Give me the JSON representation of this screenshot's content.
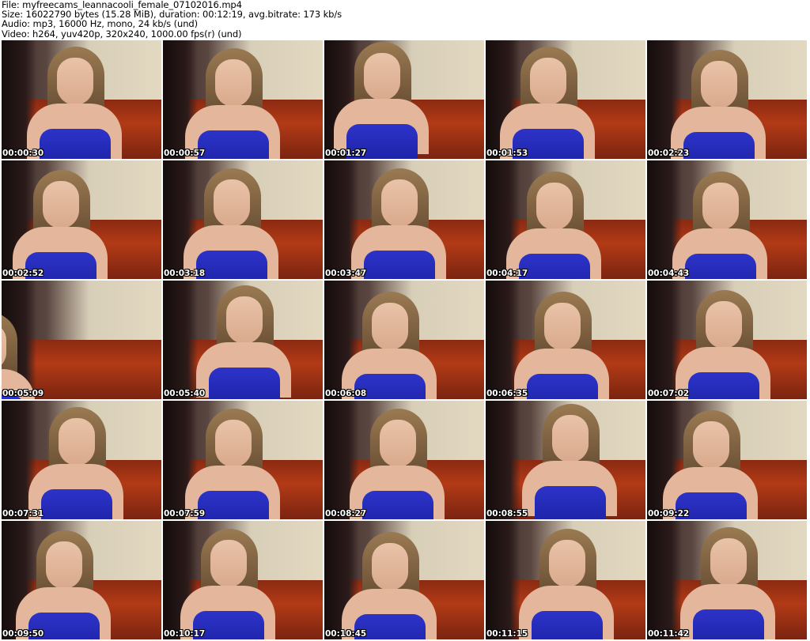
{
  "header": {
    "file_line": "File: myfreecams_leannacooli_female_07102016.mp4",
    "size_line": "Size: 16022790 bytes (15.28 MiB), duration: 00:12:19, avg.bitrate: 173 kb/s",
    "audio_line": "Audio: mp3, 16000 Hz, mono, 24 kb/s (und)",
    "video_line": "Video: h264, yuv420p, 320x240, 1000.00 fps(r) (und)"
  },
  "thumbnails": [
    {
      "timestamp": "00:00:30"
    },
    {
      "timestamp": "00:00:57"
    },
    {
      "timestamp": "00:01:27"
    },
    {
      "timestamp": "00:01:53"
    },
    {
      "timestamp": "00:02:23"
    },
    {
      "timestamp": "00:02:52"
    },
    {
      "timestamp": "00:03:18"
    },
    {
      "timestamp": "00:03:47"
    },
    {
      "timestamp": "00:04:17"
    },
    {
      "timestamp": "00:04:43"
    },
    {
      "timestamp": "00:05:09"
    },
    {
      "timestamp": "00:05:40"
    },
    {
      "timestamp": "00:06:08"
    },
    {
      "timestamp": "00:06:35"
    },
    {
      "timestamp": "00:07:02"
    },
    {
      "timestamp": "00:07:31"
    },
    {
      "timestamp": "00:07:59"
    },
    {
      "timestamp": "00:08:27"
    },
    {
      "timestamp": "00:08:55"
    },
    {
      "timestamp": "00:09:22"
    },
    {
      "timestamp": "00:09:50"
    },
    {
      "timestamp": "00:10:17"
    },
    {
      "timestamp": "00:10:45"
    },
    {
      "timestamp": "00:11:15"
    },
    {
      "timestamp": "00:11:42"
    }
  ],
  "colors": {
    "background": "#ffffff",
    "timestamp_text": "#ffffff",
    "timestamp_outline": "#000000",
    "top_blue": "#2d33c8",
    "bed_red": "#b23a16"
  }
}
